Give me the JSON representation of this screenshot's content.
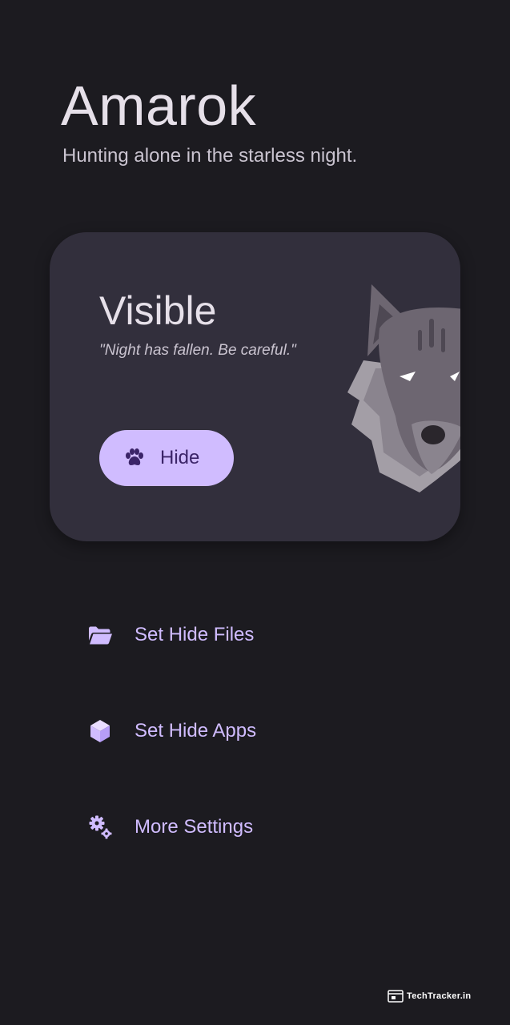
{
  "app": {
    "title": "Amarok",
    "subtitle": "Hunting alone in the starless night."
  },
  "status_card": {
    "state": "Visible",
    "quote": "\"Night has fallen. Be careful.\"",
    "action_label": "Hide",
    "action_icon": "paw-icon",
    "illustration": "wolf-illustration"
  },
  "menu": {
    "items": [
      {
        "label": "Set Hide Files",
        "icon": "folder-open-icon"
      },
      {
        "label": "Set Hide Apps",
        "icon": "cube-icon"
      },
      {
        "label": "More Settings",
        "icon": "gears-icon"
      }
    ]
  },
  "watermark": {
    "text": "TechTracker.in"
  },
  "colors": {
    "background": "#1c1b20",
    "card": "#322f3c",
    "accent": "#d0bcff",
    "on_accent": "#3b2468",
    "text_primary": "#e6e0e9",
    "text_secondary": "#cac4d0"
  }
}
